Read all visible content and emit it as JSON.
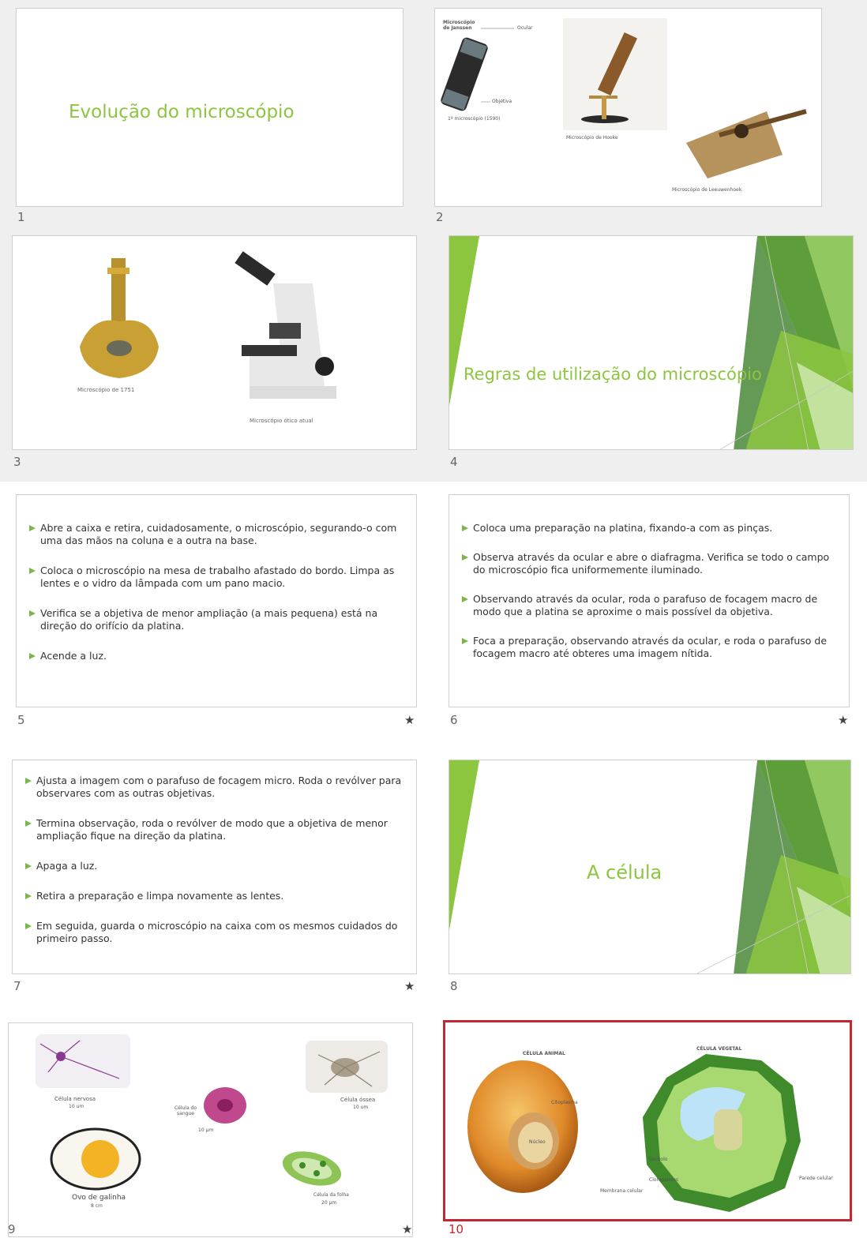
{
  "slides": [
    {
      "number": "1",
      "title": "Evolução do microscópio"
    },
    {
      "number": "2",
      "captions": {
        "janssen_title": "Microscópio de Janssen",
        "ocular": "Ocular",
        "objetiva": "Objetiva",
        "first": "1º microscópio (1590)",
        "hooke": "Microscópio de Hooke",
        "leeuwenhoek": "Microscópio de Leeuwenhoek"
      }
    },
    {
      "number": "3",
      "captions": {
        "m1751": "Microscópio de 1751",
        "modern": "Microscópio ótico atual"
      }
    },
    {
      "number": "4",
      "title": "Regras de utilização do microscópio"
    },
    {
      "number": "5",
      "star": "★",
      "bullets": [
        "Abre a caixa e retira, cuidadosamente, o microscópio, segurando-o com uma das mãos na coluna e a outra na base.",
        "Coloca o microscópio na mesa de trabalho afastado do bordo. Limpa as lentes e o vidro da lâmpada com um pano macio.",
        "Verifica se a objetiva de menor ampliação (a mais pequena) está na direção do orifício da platina.",
        "Acende a luz."
      ]
    },
    {
      "number": "6",
      "star": "★",
      "bullets": [
        "Coloca uma preparação na platina, fixando-a com as pinças.",
        "Observa através da ocular e abre o diafragma. Verifica se todo o campo do microscópio fica uniformemente iluminado.",
        "Observando através da ocular, roda o parafuso de focagem macro de modo que a platina se aproxime o mais possível da objetiva.",
        "Foca a preparação, observando através da ocular, e roda o parafuso de focagem macro até obteres uma imagem nítida."
      ]
    },
    {
      "number": "7",
      "star": "★",
      "bullets": [
        "Ajusta a imagem com o parafuso de focagem micro. Roda o revólver para observares com as outras objetivas.",
        "Termina observação, roda o revólver de modo que a objetiva de menor ampliação fique na direção da platina.",
        "Apaga a luz.",
        "Retira a preparação e limpa novamente as lentes.",
        "Em seguida, guarda o microscópio na caixa com os mesmos cuidados do primeiro passo."
      ]
    },
    {
      "number": "8",
      "title": "A célula"
    },
    {
      "number": "9",
      "star": "★",
      "captions": {
        "nervosa": "Célula nervosa",
        "nervosa_size": "10 um",
        "sangue": "Célula do sangue",
        "sangue_size": "10 µm",
        "ossea": "Célula óssea",
        "ossea_size": "10 um",
        "ovo": "Ovo de galinha",
        "ovo_size": "8 cm",
        "folha": "Célula da folha",
        "folha_size": "20 µm"
      }
    },
    {
      "number": "10",
      "selected": true,
      "captions": {
        "animal": "CÉLULA ANIMAL",
        "vegetal": "CÉLULA VEGETAL",
        "nucleo": "Núcleo",
        "citoplasma": "Citoplasma",
        "membrana": "Membrana celular",
        "cloroplastos": "Cloroplastos",
        "vacuolo": "Vacúolo",
        "parede": "Parede celular"
      }
    }
  ],
  "colors": {
    "accent_green": "#8cc63f",
    "bullet_green": "#7ab648",
    "selection_red": "#c2262e"
  }
}
